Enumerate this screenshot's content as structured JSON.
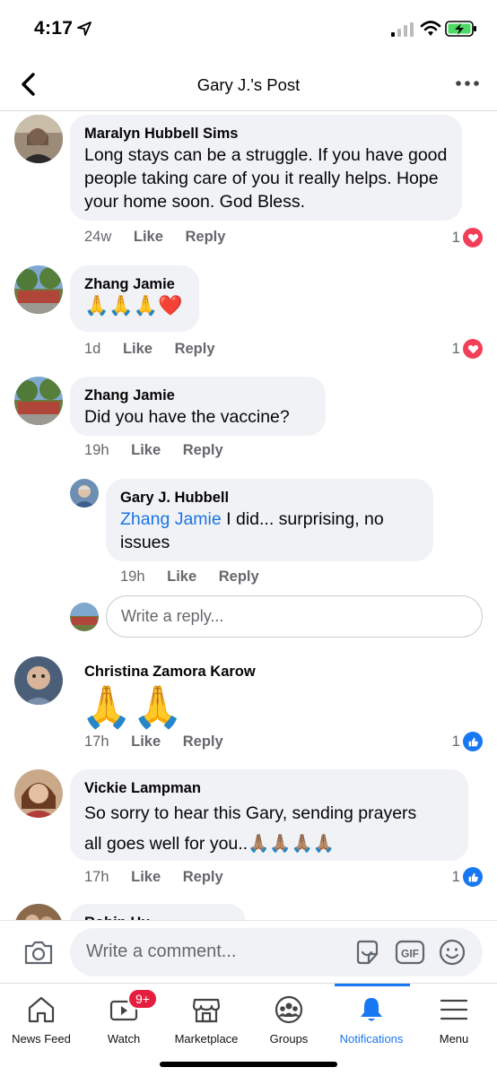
{
  "status_bar": {
    "time": "4:17"
  },
  "header": {
    "title": "Gary J.'s Post"
  },
  "comments": [
    {
      "author": "Maralyn Hubbell Sims",
      "text": "Long stays can be a struggle.  If you have good people taking care of you it really helps.  Hope your home soon.  God Bless.",
      "time": "24w",
      "like": "Like",
      "reply": "Reply",
      "reaction_count": "1",
      "reaction": "heart-icon"
    },
    {
      "author": "Zhang Jamie",
      "text": "🙏🙏🙏❤️",
      "time": "1d",
      "like": "Like",
      "reply": "Reply",
      "reaction_count": "1",
      "reaction": "heart-icon"
    },
    {
      "author": "Zhang Jamie",
      "text": "Did you have the vaccine?",
      "time": "19h",
      "like": "Like",
      "reply": "Reply"
    },
    {
      "author": "Christina Zamora Karow",
      "text": "🙏🙏",
      "time": "17h",
      "like": "Like",
      "reply": "Reply",
      "reaction_count": "1",
      "reaction": "like-icon"
    },
    {
      "author": "Vickie Lampman",
      "text_line1": "So sorry to hear this Gary, sending prayers",
      "text_line2": "all goes well for you..🙏🏽🙏🏽🙏🏽🙏🏽",
      "time": "17h",
      "like": "Like",
      "reply": "Reply",
      "reaction_count": "1",
      "reaction": "like-icon"
    },
    {
      "author": "Robin Hu..."
    }
  ],
  "reply": {
    "author": "Gary J. Hubbell",
    "mention": "Zhang Jamie",
    "text": " I did...  surprising, no issues",
    "time": "19h",
    "like": "Like",
    "reply": "Reply"
  },
  "reply_input": {
    "placeholder": "Write a reply..."
  },
  "composer": {
    "placeholder": "Write a comment..."
  },
  "tabs": [
    {
      "label": "News Feed",
      "icon": "home-icon"
    },
    {
      "label": "Watch",
      "icon": "watch-icon",
      "badge": "9+"
    },
    {
      "label": "Marketplace",
      "icon": "marketplace-icon"
    },
    {
      "label": "Groups",
      "icon": "groups-icon"
    },
    {
      "label": "Notifications",
      "icon": "bell-icon",
      "active": true
    },
    {
      "label": "Menu",
      "icon": "menu-icon"
    }
  ],
  "colors": {
    "accent": "#1877f2",
    "heart": "#f33e58",
    "bubble": "#f0f2f5",
    "badge": "#e41e3f"
  }
}
